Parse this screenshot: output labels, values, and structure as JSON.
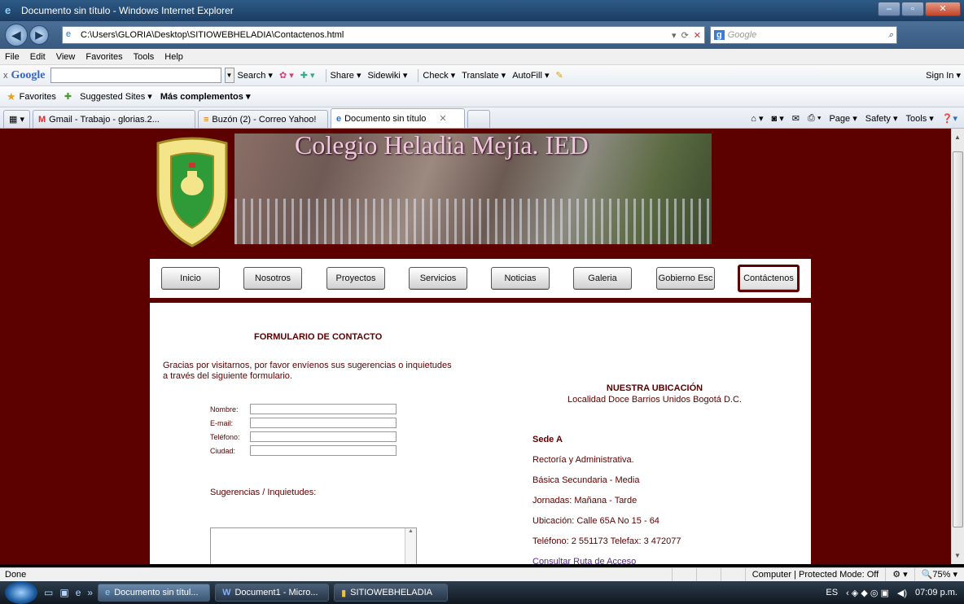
{
  "window": {
    "title": "Documento sin título - Windows Internet Explorer"
  },
  "address": {
    "url": "C:\\Users\\GLORIA\\Desktop\\SITIOWEBHELADIA\\Contactenos.html",
    "search_placeholder": "Google"
  },
  "menu": [
    "File",
    "Edit",
    "View",
    "Favorites",
    "Tools",
    "Help"
  ],
  "google_toolbar": {
    "logo": "Google",
    "items": [
      "Search ▾",
      "Share ▾",
      "Sidewiki ▾",
      "Check ▾",
      "Translate ▾",
      "AutoFill ▾"
    ],
    "signin": "Sign In ▾"
  },
  "favorites": {
    "label": "Favorites",
    "suggested": "Suggested Sites ▾",
    "more": "Más complementos ▾"
  },
  "tabs": [
    {
      "label": "Gmail - Trabajo - glorias.2..."
    },
    {
      "label": "Buzón (2) - Correo Yahoo!"
    },
    {
      "label": "Documento sin título"
    }
  ],
  "command_bar": [
    "Page ▾",
    "Safety ▾",
    "Tools ▾"
  ],
  "site": {
    "title": "Colegio Heladia Mejía. IED",
    "nav": [
      "Inicio",
      "Nosotros",
      "Proyectos",
      "Servicios",
      "Noticias",
      "Galeria",
      "Gobierno Esc",
      "Contáctenos"
    ],
    "form": {
      "heading": "FORMULARIO DE CONTACTO",
      "intro1": "Gracias por visitarnos, por favor envíenos sus sugerencias o inquietudes",
      "intro2": "a través del siguiente formulario.",
      "fields": [
        "Nombre:",
        "E-mail:",
        "Teléfono:",
        "Ciudad:"
      ],
      "suggest_label": "Sugerencias / Inquietudes:"
    },
    "location": {
      "heading": "NUESTRA UBICACIÓN",
      "subheading": "Localidad Doce Barrios Unidos Bogotá D.C.",
      "sede": "Sede A",
      "lines": [
        "Rectoría y Administrativa.",
        "Básica Secundaria - Media",
        "Jornadas: Mañana - Tarde",
        "Ubicación: Calle 65A No 15 - 64",
        "Teléfono: 2 551173 Telefax: 3 472077"
      ],
      "link": "Consultar Ruta de Acceso"
    }
  },
  "status": {
    "text": "Done",
    "zone": "Computer | Protected Mode: Off",
    "zoom": "75%"
  },
  "taskbar": {
    "tasks": [
      "Documento sin títul...",
      "Document1 - Micro...",
      "SITIOWEBHELADIA"
    ],
    "lang": "ES",
    "time": "07:09 p.m."
  }
}
